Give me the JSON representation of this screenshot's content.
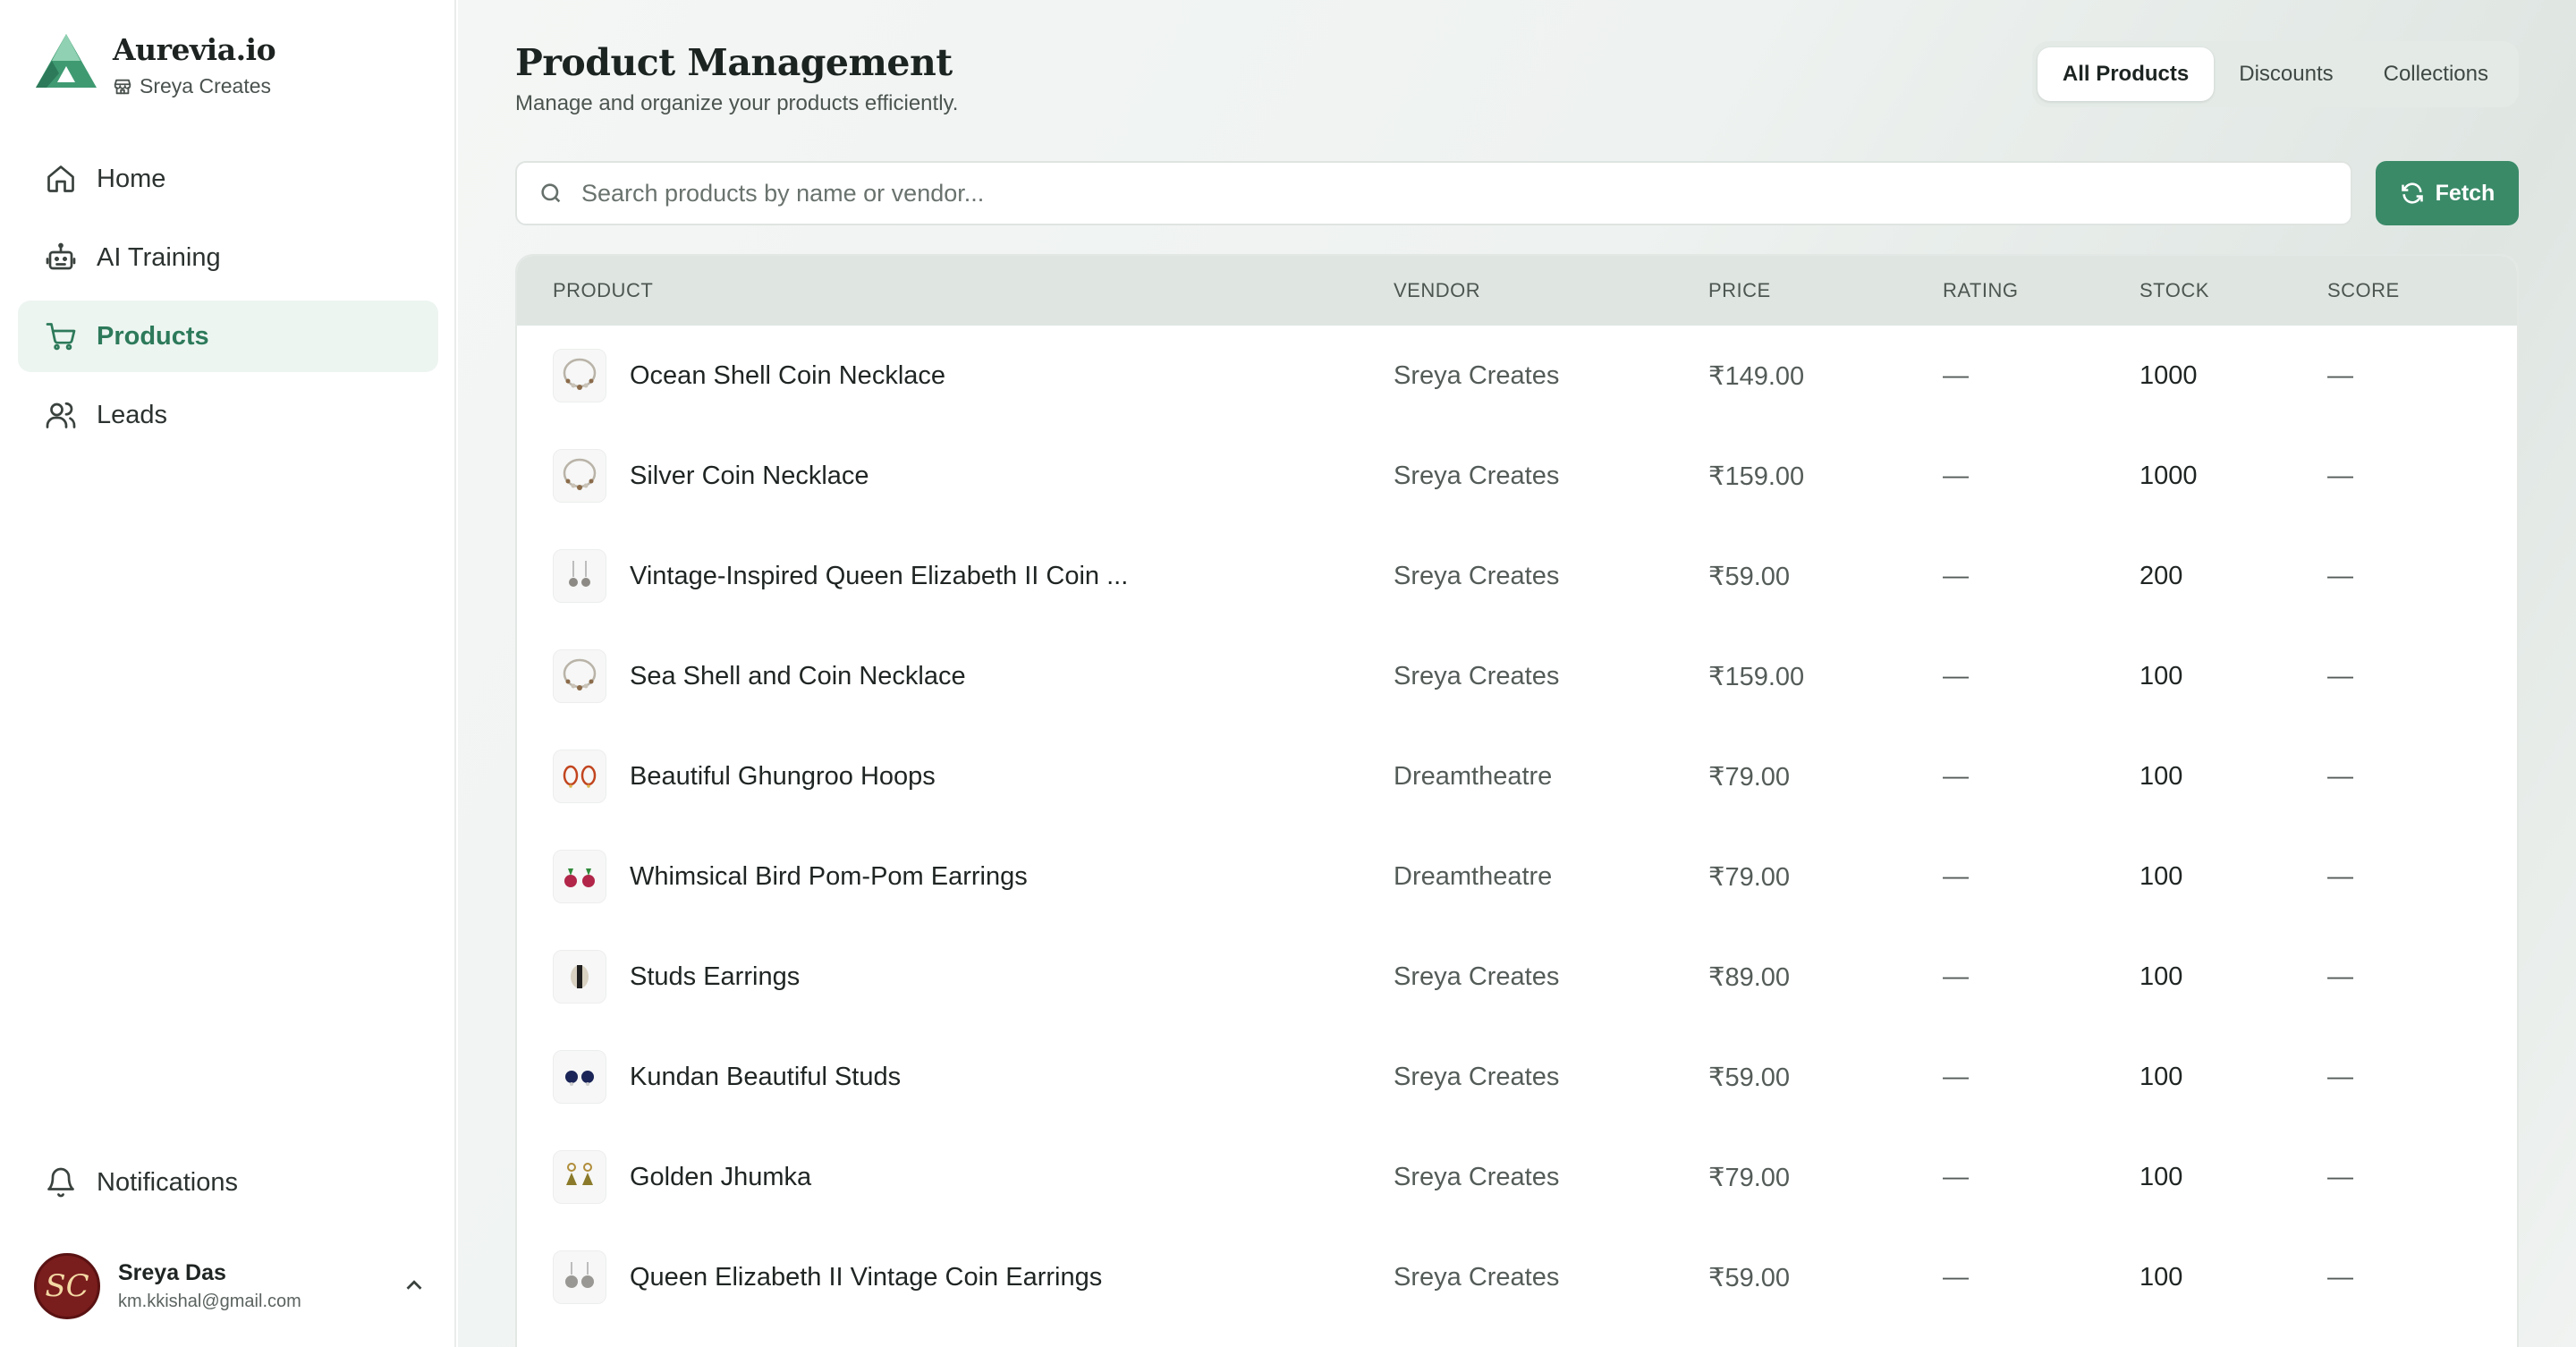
{
  "brand": {
    "name": "Aurevia.io",
    "store": "Sreya Creates"
  },
  "nav": [
    {
      "label": "Home",
      "icon": "home-icon",
      "active": false
    },
    {
      "label": "AI Training",
      "icon": "robot-icon",
      "active": false
    },
    {
      "label": "Products",
      "icon": "cart-icon",
      "active": true
    },
    {
      "label": "Leads",
      "icon": "users-icon",
      "active": false
    }
  ],
  "notifications": {
    "label": "Notifications"
  },
  "user": {
    "name": "Sreya Das",
    "email": "km.kkishal@gmail.com",
    "initials": "SC"
  },
  "page": {
    "title": "Product Management",
    "subtitle": "Manage and organize your products efficiently."
  },
  "tabs": [
    {
      "label": "All Products",
      "active": true
    },
    {
      "label": "Discounts",
      "active": false
    },
    {
      "label": "Collections",
      "active": false
    }
  ],
  "search": {
    "placeholder": "Search products by name or vendor...",
    "value": ""
  },
  "fetch_button": {
    "label": "Fetch"
  },
  "table": {
    "headers": [
      "PRODUCT",
      "VENDOR",
      "PRICE",
      "RATING",
      "STOCK",
      "SCORE"
    ],
    "rows": [
      {
        "product": "Ocean Shell Coin Necklace",
        "vendor": "Sreya Creates",
        "price": "₹149.00",
        "rating": "—",
        "stock": "1000",
        "score": "—",
        "thumb": "necklace"
      },
      {
        "product": "Silver Coin Necklace",
        "vendor": "Sreya Creates",
        "price": "₹159.00",
        "rating": "—",
        "stock": "1000",
        "score": "—",
        "thumb": "necklace"
      },
      {
        "product": "Vintage-Inspired Queen Elizabeth II Coin ...",
        "vendor": "Sreya Creates",
        "price": "₹59.00",
        "rating": "—",
        "stock": "200",
        "score": "—",
        "thumb": "earrings"
      },
      {
        "product": "Sea Shell and Coin Necklace",
        "vendor": "Sreya Creates",
        "price": "₹159.00",
        "rating": "—",
        "stock": "100",
        "score": "—",
        "thumb": "necklace"
      },
      {
        "product": "Beautiful Ghungroo Hoops",
        "vendor": "Dreamtheatre",
        "price": "₹79.00",
        "rating": "—",
        "stock": "100",
        "score": "—",
        "thumb": "hoops"
      },
      {
        "product": "Whimsical Bird Pom-Pom Earrings",
        "vendor": "Dreamtheatre",
        "price": "₹79.00",
        "rating": "—",
        "stock": "100",
        "score": "—",
        "thumb": "pompom"
      },
      {
        "product": "Studs Earrings",
        "vendor": "Sreya Creates",
        "price": "₹89.00",
        "rating": "—",
        "stock": "100",
        "score": "—",
        "thumb": "studs"
      },
      {
        "product": "Kundan Beautiful Studs",
        "vendor": "Sreya Creates",
        "price": "₹59.00",
        "rating": "—",
        "stock": "100",
        "score": "—",
        "thumb": "bluestuds"
      },
      {
        "product": "Golden Jhumka",
        "vendor": "Sreya Creates",
        "price": "₹79.00",
        "rating": "—",
        "stock": "100",
        "score": "—",
        "thumb": "jhumka"
      },
      {
        "product": "Queen Elizabeth II Vintage Coin Earrings",
        "vendor": "Sreya Creates",
        "price": "₹59.00",
        "rating": "—",
        "stock": "100",
        "score": "—",
        "thumb": "coins"
      }
    ]
  },
  "colors": {
    "accent": "#3a8a68",
    "active_nav_bg": "#edf5f1",
    "active_nav_text": "#2d7a5a"
  }
}
